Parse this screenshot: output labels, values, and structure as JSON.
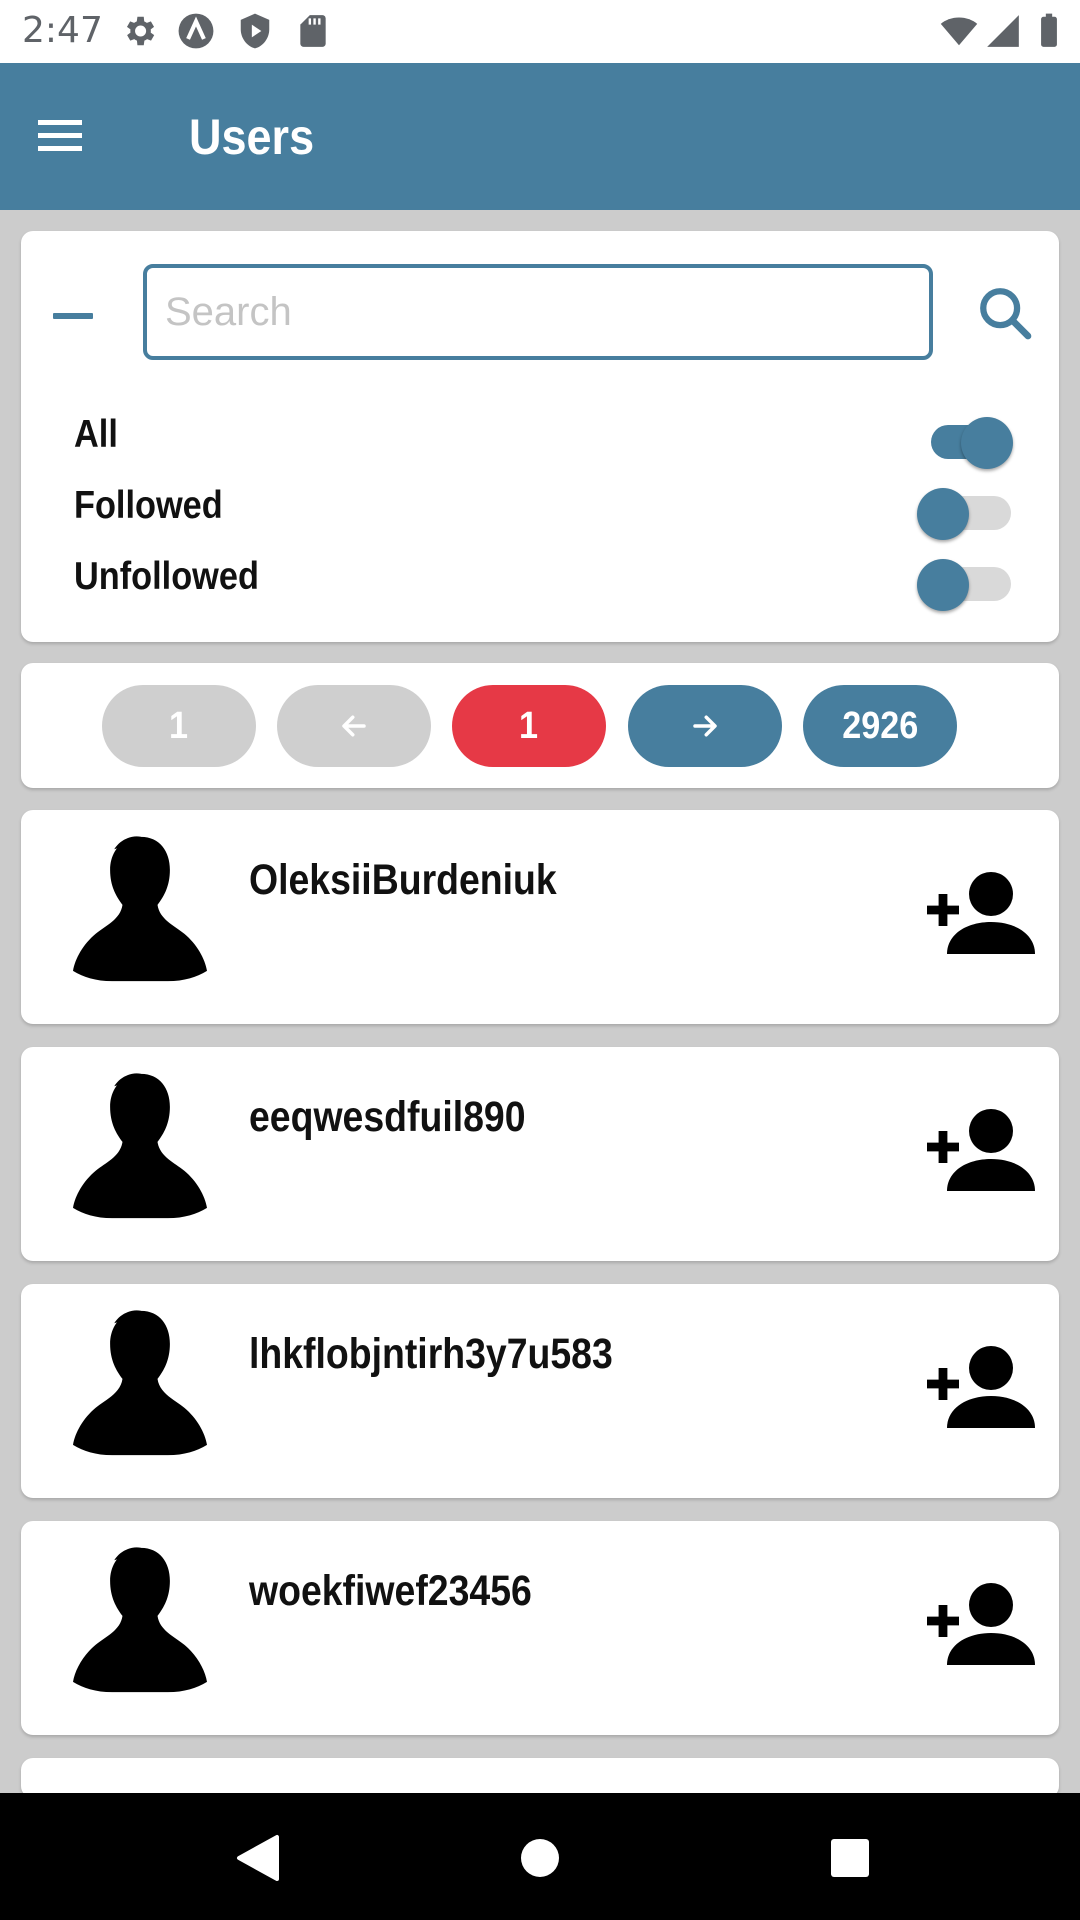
{
  "status_bar": {
    "time": "2:47",
    "icons": [
      "settings-icon",
      "app-icon",
      "shield-play-icon",
      "sd-card-icon",
      "wifi-icon",
      "signal-icon",
      "battery-icon"
    ]
  },
  "app_bar": {
    "title": "Users",
    "menu_icon": "menu-icon"
  },
  "colors": {
    "primary": "#477e9e",
    "accent_red": "#e63946",
    "disabled_grey": "#cfcfcf",
    "background": "#cccccc"
  },
  "filter": {
    "search_placeholder": "Search",
    "search_value": "",
    "options": [
      {
        "label": "All",
        "checked": true
      },
      {
        "label": "Followed",
        "checked": false
      },
      {
        "label": "Unfollowed",
        "checked": false
      }
    ]
  },
  "pagination": {
    "first_label": "1",
    "prev_icon": "arrow-left-icon",
    "current_label": "1",
    "next_icon": "arrow-right-icon",
    "last_label": "2926"
  },
  "users": [
    {
      "name": "OleksiiBurdeniuk",
      "avatar": "user-silhouette-icon",
      "action": "add-user-icon"
    },
    {
      "name": "eeqwesdfuil890",
      "avatar": "user-silhouette-icon",
      "action": "add-user-icon"
    },
    {
      "name": "lhkflobjntirh3y7u583",
      "avatar": "user-silhouette-icon",
      "action": "add-user-icon"
    },
    {
      "name": "woekfiwef23456",
      "avatar": "user-silhouette-icon",
      "action": "add-user-icon"
    }
  ],
  "nav_bar": {
    "buttons": [
      "back-icon",
      "home-icon",
      "recents-icon"
    ]
  }
}
